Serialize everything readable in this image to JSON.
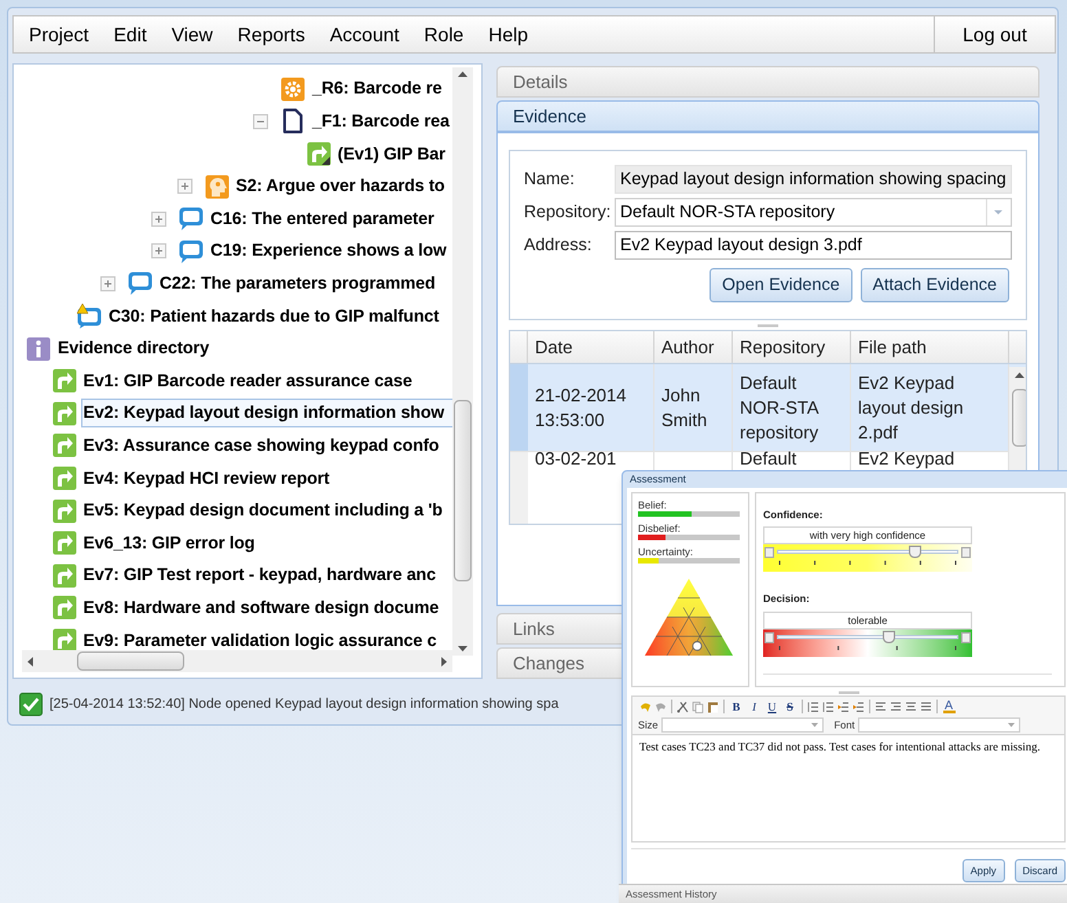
{
  "menu": {
    "items": [
      "Project",
      "Edit",
      "View",
      "Reports",
      "Account",
      "Role",
      "Help"
    ],
    "logout": "Log out"
  },
  "tree": {
    "items": [
      {
        "children": [
          {
            "children": [
              {
                "children": [
                  {
                    "children": [
                      {
                        "children": [
                          {
                            "children": [
                              {
                                "children": [
                                  {
                                    "children": [
                                      {
                                        "children": [
                                          {
                                            "children": [
                                              {
                                                "label": "_R6: Barcode re",
                                                "kind": "rule",
                                                "selected": false
                                              },
                                              {
                                                "label": "_F1: Barcode rea",
                                                "kind": "fact",
                                                "selected": false,
                                                "expanded": true,
                                                "children": [
                                                  {
                                                    "label": "(Ev1) GIP Bar",
                                                    "kind": "evidence-link",
                                                    "selected": false
                                                  }
                                                ]
                                              }
                                            ]
                                          }
                                        ]
                                      }
                                    ]
                                  },
                                  {
                                    "label": "S2: Argue over hazards to",
                                    "kind": "strategy",
                                    "selected": false,
                                    "expanded": false
                                  }
                                ]
                              },
                              {
                                "label": "C16: The entered parameter",
                                "kind": "context",
                                "selected": false,
                                "expanded": false
                              },
                              {
                                "label": "C19: Experience shows a low",
                                "kind": "context",
                                "selected": false,
                                "expanded": false
                              }
                            ]
                          }
                        ]
                      },
                      {
                        "label": "C22: The parameters programmed",
                        "kind": "context",
                        "selected": false,
                        "expanded": false
                      }
                    ]
                  }
                ]
              },
              {
                "label": "C30: Patient hazards due to GIP malfunct",
                "kind": "context-warning",
                "selected": false
              }
            ]
          }
        ]
      },
      {
        "label": "Evidence directory",
        "kind": "info",
        "selected": false,
        "children": [
          {
            "label": "Ev1: GIP Barcode reader assurance case",
            "kind": "evidence",
            "selected": false
          },
          {
            "label": "Ev2: Keypad layout design information show",
            "kind": "evidence",
            "selected": true
          },
          {
            "label": "Ev3: Assurance case showing keypad confo",
            "kind": "evidence",
            "selected": false
          },
          {
            "label": "Ev4: Keypad HCI review report",
            "kind": "evidence",
            "selected": false
          },
          {
            "label": "Ev5: Keypad design document including a 'b",
            "kind": "evidence",
            "selected": false
          },
          {
            "label": "Ev6_13: GIP error log",
            "kind": "evidence",
            "selected": false
          },
          {
            "label": "Ev7: GIP Test report - keypad, hardware anc",
            "kind": "evidence",
            "selected": false
          },
          {
            "label": "Ev8: Hardware and software design docume",
            "kind": "evidence",
            "selected": false
          },
          {
            "label": "Ev9: Parameter validation logic assurance c",
            "kind": "evidence",
            "selected": false
          }
        ]
      }
    ]
  },
  "status_bar": {
    "message": "[25-04-2014 13:52:40] Node opened Keypad layout design information showing spa"
  },
  "sections": [
    {
      "label": "Details",
      "expanded": false
    },
    {
      "label": "Evidence",
      "expanded": true
    },
    {
      "label": "Links",
      "expanded": false
    },
    {
      "label": "Changes",
      "expanded": false
    }
  ],
  "evidence": {
    "fields": [
      {
        "label": "Name:",
        "value": "Keypad layout design information showing spacing",
        "kind": "readonly"
      },
      {
        "label": "Repository:",
        "value": "Default NOR-STA repository",
        "kind": "select"
      },
      {
        "label": "Address:",
        "value": "Ev2 Keypad layout design 3.pdf",
        "kind": "text"
      }
    ],
    "buttons": [
      "Open Evidence",
      "Attach Evidence"
    ],
    "table": {
      "columns": [
        "Date",
        "Author",
        "Repository",
        "File path"
      ],
      "rows": [
        {
          "cells": [
            "21-02-2014 13:53:00",
            "John Smith",
            "Default NOR-STA repository",
            "Ev2 Keypad layout design 2.pdf"
          ],
          "selected": true
        },
        {
          "cells": [
            "03-02-201",
            "",
            "Default",
            "Ev2 Keypad"
          ],
          "selected": false
        }
      ]
    }
  },
  "assessment": {
    "title": "Assessment",
    "measures": [
      {
        "label": "Belief:",
        "level": 0.53,
        "color": "#22c322"
      },
      {
        "label": "Disbelief:",
        "level": 0.27,
        "color": "#e11d1d"
      },
      {
        "label": "Uncertainty:",
        "level": 0.2,
        "color": "#e8e800"
      }
    ],
    "confidence": {
      "label": "Confidence:",
      "value": "with very high confidence",
      "level": 0.76
    },
    "decision": {
      "label": "Decision:",
      "value": "tolerable",
      "level": 0.62
    },
    "toolbar": {
      "format_buttons": [
        "B",
        "I",
        "U",
        "S"
      ],
      "color_button": "A"
    },
    "size_label": "Size",
    "font_label": "Font",
    "text": "Test cases TC23 and TC37 did not pass. Test cases for intentional attacks are missing.",
    "buttons": [
      "Apply",
      "Discard"
    ],
    "history": "Assessment History"
  }
}
